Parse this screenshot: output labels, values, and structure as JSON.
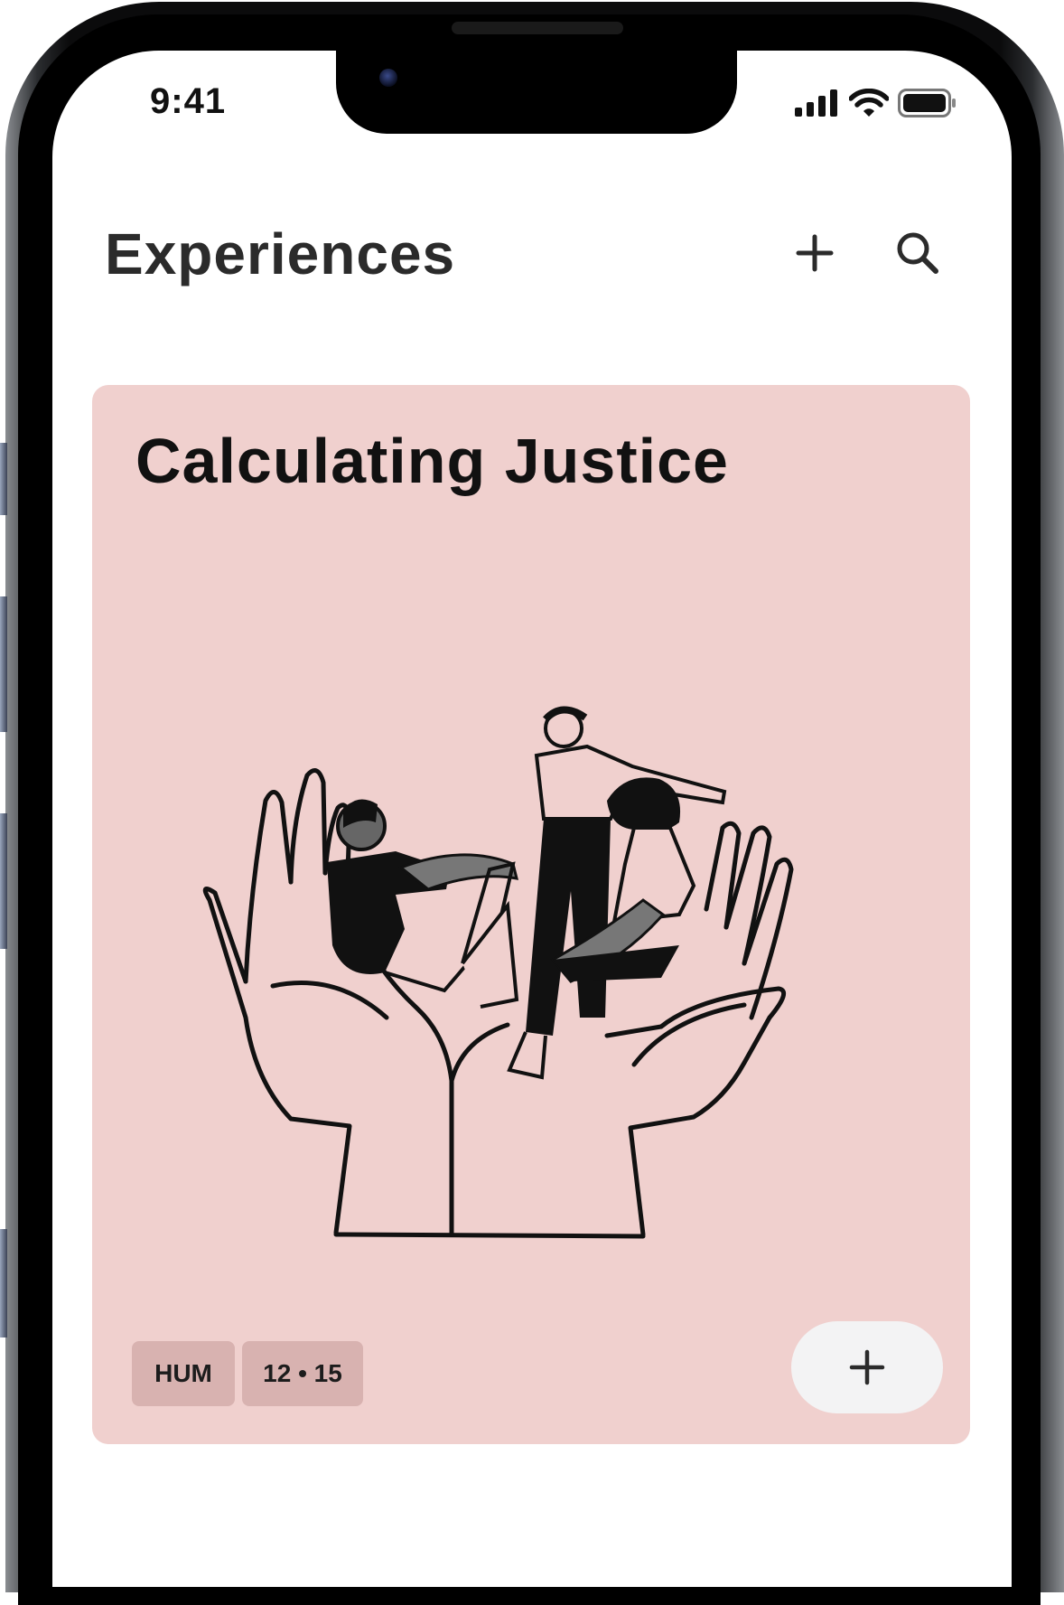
{
  "status_bar": {
    "time": "9:41"
  },
  "header": {
    "title": "Experiences",
    "add_icon": "plus-icon",
    "search_icon": "search-icon"
  },
  "card": {
    "title": "Calculating Justice",
    "tags": [
      "HUM",
      "12 • 15"
    ],
    "add_icon": "plus-icon",
    "background_color": "#f0d0ce",
    "tag_color": "#d8b2b0"
  }
}
